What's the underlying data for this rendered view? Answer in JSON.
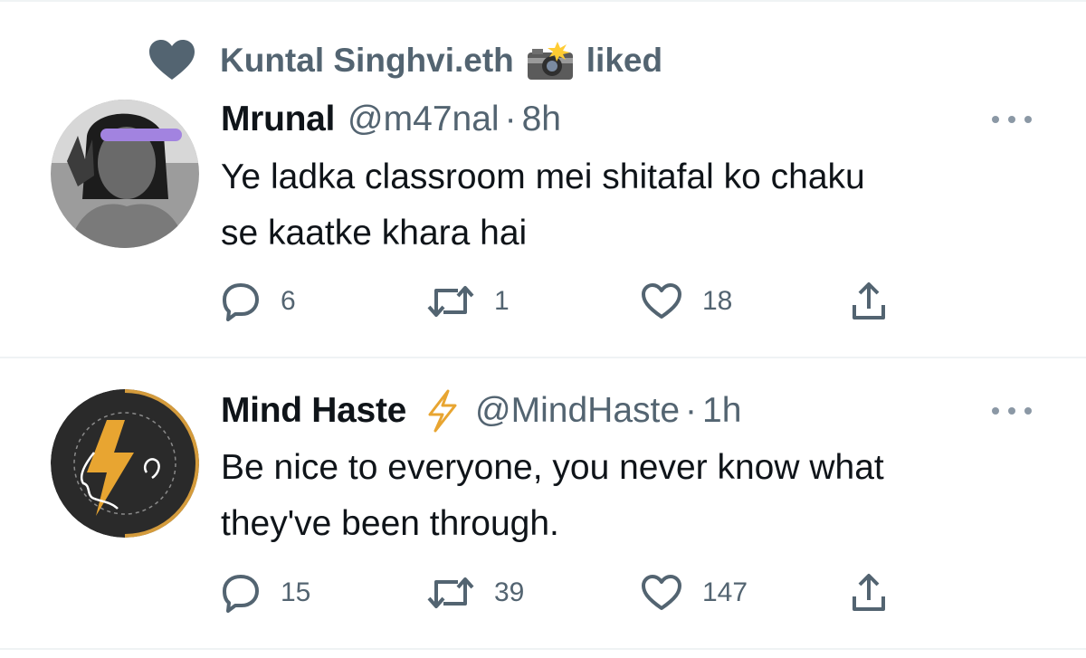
{
  "tweets": [
    {
      "social_context": {
        "name": "Kuntal Singhvi.eth",
        "action": "liked"
      },
      "display_name": "Mrunal",
      "handle": "@m47nal",
      "separator": "·",
      "time": "8h",
      "text_lines": [
        "Ye ladka classroom mei shitafal ko chaku",
        "se kaatke khara hai"
      ],
      "replies": "6",
      "retweets": "1",
      "likes": "18"
    },
    {
      "display_name": "Mind Haste",
      "verified_icon": "lightning-bolt-icon",
      "handle": "@MindHaste",
      "separator": "·",
      "time": "1h",
      "text_lines": [
        "Be nice to everyone, you never know what",
        "they've been through."
      ],
      "replies": "15",
      "retweets": "39",
      "likes": "147"
    }
  ],
  "colors": {
    "text_primary": "#0f1419",
    "text_secondary": "#536471",
    "divider": "#eff3f4",
    "bolt": "#e8a531"
  }
}
